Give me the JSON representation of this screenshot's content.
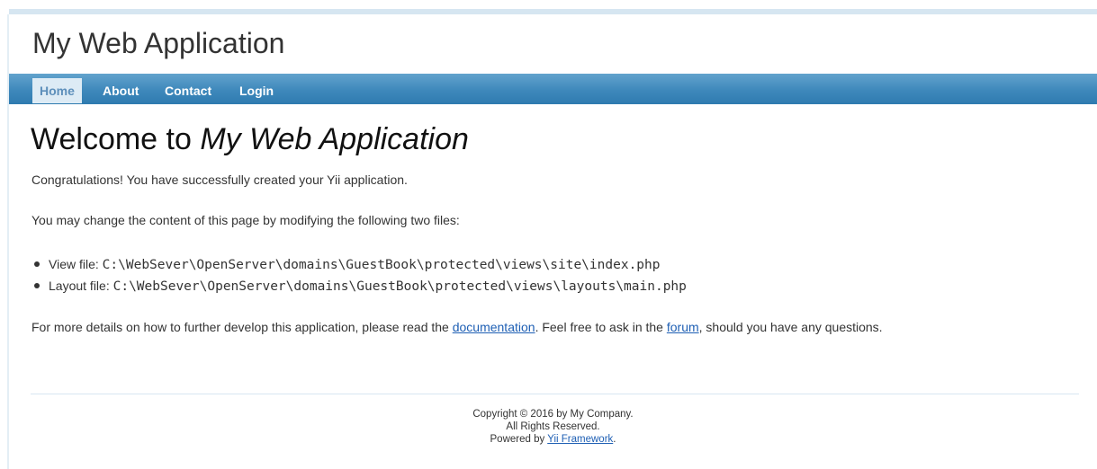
{
  "header": {
    "title": "My Web Application"
  },
  "nav": {
    "items": [
      {
        "label": "Home",
        "active": true
      },
      {
        "label": "About",
        "active": false
      },
      {
        "label": "Contact",
        "active": false
      },
      {
        "label": "Login",
        "active": false
      }
    ]
  },
  "main": {
    "heading_prefix": "Welcome to ",
    "heading_app": "My Web Application",
    "congrats": "Congratulations! You have successfully created your Yii application.",
    "change_intro": "You may change the content of this page by modifying the following two files:",
    "files": [
      {
        "label": "View file: ",
        "path": "C:\\WebSever\\OpenServer\\domains\\GuestBook\\protected\\views\\site\\index.php"
      },
      {
        "label": "Layout file: ",
        "path": "C:\\WebSever\\OpenServer\\domains\\GuestBook\\protected\\views\\layouts\\main.php"
      }
    ],
    "details_before": "For more details on how to further develop this application, please read the ",
    "documentation_link": "documentation",
    "details_middle": ". Feel free to ask in the ",
    "forum_link": "forum",
    "details_after": ", should you have any questions."
  },
  "footer": {
    "copyright": "Copyright © 2016 by My Company.",
    "rights": "All Rights Reserved.",
    "powered_prefix": "Powered by ",
    "powered_link": "Yii Framework",
    "powered_suffix": "."
  },
  "colors": {
    "nav_bar": "#3e88bb",
    "nav_active_bg": "#ddebf5",
    "link": "#1e5fb4",
    "top_bar": "#d6e6f1"
  }
}
